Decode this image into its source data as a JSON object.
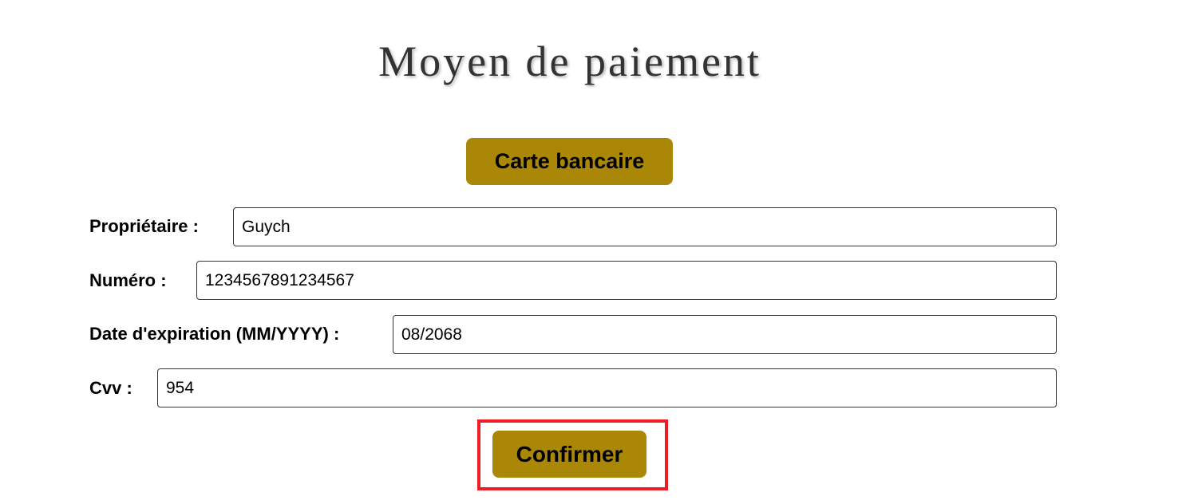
{
  "page": {
    "title": "Moyen de paiement"
  },
  "payment_method_button": "Carte bancaire",
  "form": {
    "owner": {
      "label": "Propriétaire :",
      "value": "Guych"
    },
    "number": {
      "label": "Numéro :",
      "value": "1234567891234567"
    },
    "expiration": {
      "label": "Date d'expiration (MM/YYYY) :",
      "value": "08/2068"
    },
    "cvv": {
      "label": "Cvv :",
      "value": "954"
    }
  },
  "confirm_button": "Confirmer",
  "colors": {
    "button": "#ab8707",
    "highlight": "#ee1c24"
  }
}
